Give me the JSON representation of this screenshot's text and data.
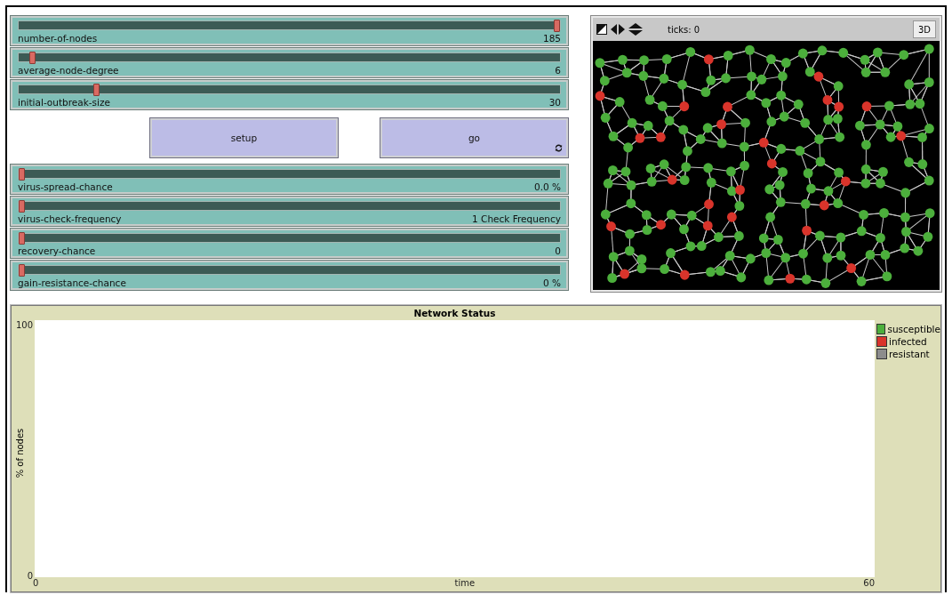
{
  "sliders_top": [
    {
      "label": "number-of-nodes",
      "value": "185",
      "level": 1
    },
    {
      "label": "average-node-degree",
      "value": "6",
      "level": 0.02
    },
    {
      "label": "initial-outbreak-size",
      "value": "30",
      "level": 0.14
    }
  ],
  "buttons": [
    {
      "label": "setup",
      "forever": false
    },
    {
      "label": "go",
      "forever": true
    }
  ],
  "sliders_bottom": [
    {
      "label": "virus-spread-chance",
      "value": "0.0 %",
      "level": 0
    },
    {
      "label": "virus-check-frequency",
      "value": "1 Check Frequency",
      "level": 0
    },
    {
      "label": "recovery-chance",
      "value": "0",
      "level": 0
    },
    {
      "label": "gain-resistance-chance",
      "value": "0 %",
      "level": 0
    }
  ],
  "view": {
    "ticks": "ticks: 0",
    "button_3d": "3D"
  },
  "plot": {
    "title": "Network Status",
    "x_axis_label": "time",
    "y_axis_label": "% of nodes",
    "x_min": "0",
    "x_max": "60",
    "y_min": "0",
    "y_max": "100",
    "legend": [
      {
        "name": "susceptible",
        "color": "#4caf3c"
      },
      {
        "name": "infected",
        "color": "#d9342b"
      },
      {
        "name": "resistant",
        "color": "#8c8c8c"
      }
    ]
  }
}
